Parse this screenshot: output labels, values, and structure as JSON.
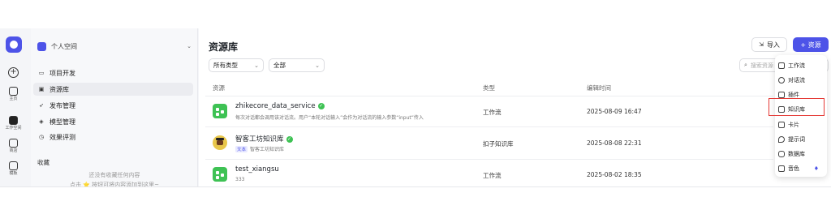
{
  "rail": {
    "home_label": "主页",
    "workspace_label": "工作空间",
    "store_label": "商店",
    "templates_label": "模板"
  },
  "sidebar": {
    "space_name": "个人空间",
    "items": [
      {
        "label": "项目开发"
      },
      {
        "label": "资源库"
      },
      {
        "label": "发布管理"
      },
      {
        "label": "模型管理"
      },
      {
        "label": "效果评测"
      }
    ],
    "favorites_title": "收藏",
    "favorites_empty_1": "还没有收藏任何内容",
    "favorites_empty_2": "点击 ⭐ 按钮可将内容添加到这里~"
  },
  "main": {
    "title": "资源库",
    "import_label": "导入",
    "resource_label": "+ 资源",
    "type_filter": "所有类型",
    "scope_filter": "全部",
    "search_placeholder": "搜索资源",
    "columns": {
      "resource": "资源",
      "type": "类型",
      "edited": "编辑时间"
    },
    "rows": [
      {
        "name": "zhikecore_data_service",
        "desc": "每次对话都会调用该对话流。用户“本轮对话输入”会作为对话流的输入参数“input”传入",
        "tag": "",
        "type": "工作流",
        "time": "2025-08-09 16:47"
      },
      {
        "name": "智客工坊知识库",
        "desc": "智客工坊知识库",
        "tag": "文本",
        "type": "扣子知识库",
        "time": "2025-08-08 22:31"
      },
      {
        "name": "test_xiangsu",
        "desc": "333",
        "tag": "",
        "type": "工作流",
        "time": "2025-08-02 18:35"
      }
    ]
  },
  "menu": {
    "items": [
      {
        "label": "工作流",
        "icon": "workflow-icon"
      },
      {
        "label": "对话流",
        "icon": "chatflow-icon"
      },
      {
        "label": "插件",
        "icon": "plugin-icon"
      },
      {
        "label": "知识库",
        "icon": "knowledge-icon"
      },
      {
        "label": "卡片",
        "icon": "card-icon"
      },
      {
        "label": "提示词",
        "icon": "prompt-icon"
      },
      {
        "label": "数据库",
        "icon": "database-icon"
      },
      {
        "label": "音色",
        "icon": "voice-icon"
      }
    ]
  }
}
